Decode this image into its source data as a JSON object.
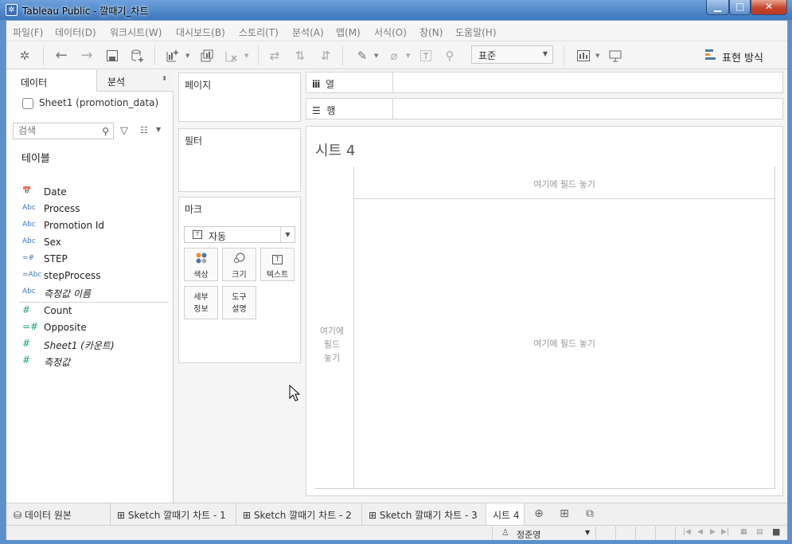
{
  "window": {
    "title": "Tableau Public - 깔때기_차트",
    "minimize": "▁",
    "maximize": "□",
    "close": "✕"
  },
  "menu": [
    "파일(F)",
    "데이터(D)",
    "워크시트(W)",
    "대시보드(B)",
    "스토리(T)",
    "분석(A)",
    "맵(M)",
    "서식(O)",
    "창(N)",
    "도움말(H)"
  ],
  "toolbar": {
    "fit_value": "표준",
    "show_me": "표현 방식"
  },
  "data_pane": {
    "tab_data": "데이터",
    "tab_analysis": "분석",
    "datasource": "Sheet1 (promotion_data)",
    "search_placeholder": "검색",
    "tables_label": "테이블",
    "dimensions": [
      {
        "icon": "📅",
        "name": "Date",
        "italic": false
      },
      {
        "icon": "Abc",
        "name": "Process",
        "italic": false
      },
      {
        "icon": "Abc",
        "name": "Promotion Id",
        "italic": false
      },
      {
        "icon": "Abc",
        "name": "Sex",
        "italic": false
      },
      {
        "icon": "=#",
        "name": "STEP",
        "italic": false
      },
      {
        "icon": "=Abc",
        "name": "stepProcess",
        "italic": false
      },
      {
        "icon": "Abc",
        "name": "측정값 이름",
        "italic": true
      }
    ],
    "measures": [
      {
        "icon": "#",
        "name": "Count",
        "italic": false
      },
      {
        "icon": "=#",
        "name": "Opposite",
        "italic": false
      },
      {
        "icon": "#",
        "name": "Sheet1 (카운트)",
        "italic": true
      },
      {
        "icon": "#",
        "name": "측정값",
        "italic": true
      }
    ]
  },
  "cards": {
    "pages": "페이지",
    "filters": "필터",
    "marks": "마크",
    "marks_type": "자동",
    "marks_type_icon": "T",
    "color": "색상",
    "size": "크기",
    "text": "텍스트",
    "text_icon": "T",
    "detail_1": "세부",
    "detail_2": "정보",
    "tooltip_1": "도구",
    "tooltip_2": "설명"
  },
  "shelves": {
    "columns": "열",
    "rows": "행"
  },
  "view": {
    "sheet_title": "시트 4",
    "drop_columns": "여기에 필드 놓기",
    "drop_rows_1": "여기에",
    "drop_rows_2": "필드",
    "drop_rows_3": "놓기",
    "drop_main": "여기에 필드 놓기"
  },
  "tabs": {
    "data_source": "데이터 원본",
    "sheets": [
      "Sketch 깔때기 차트 - 1",
      "Sketch 깔때기 차트 - 2",
      "Sketch 깔때기 차트 - 3"
    ],
    "active": "시트 4"
  },
  "status": {
    "user": "정준영"
  }
}
